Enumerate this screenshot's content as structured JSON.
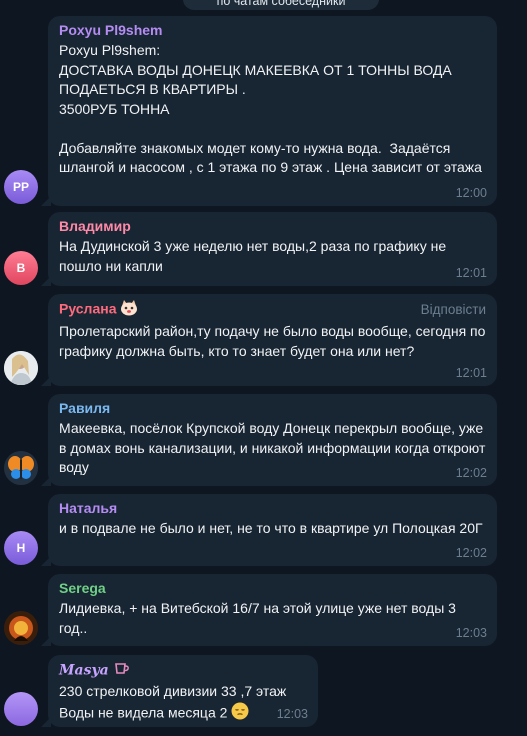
{
  "top_bar": {
    "text": "по чатам собеседники"
  },
  "messages": [
    {
      "sender": "Poxyu Pl9shem",
      "avatar_initials": "PP",
      "text": "Poxyu Pl9shem:\nДОСТАВКА ВОДЫ ДОНЕЦК МАКЕЕВКА ОТ 1 ТОННЫ ВОДА ПОДАЕТЬСЯ В КВАРТИРЫ .\n3500РУБ ТОННА\n\nДобавляйте знакомых модет кому-то нужна вода.  Задаётся шлангой и насосом , с 1 этажа по 9 этаж . Цена зависит от этажа",
      "time": "12:00"
    },
    {
      "sender": "Владимир",
      "avatar_initials": "В",
      "text": "На Дудинской 3 уже неделю нет воды,2 раза по графику не пошло ни капли",
      "time": "12:01"
    },
    {
      "sender": "Руслана",
      "reply_label": "Відповісти",
      "text": "Пролетарский район,ту подачу не было воды вообще, сегодня по графику должна быть, кто то знает будет она или нет?",
      "time": "12:01"
    },
    {
      "sender": "Равиля",
      "text": "Макеевка, посёлок Крупской воду Донецк перекрыл вообще, уже в домах вонь канализации, и никакой информации когда откроют воду",
      "time": "12:02"
    },
    {
      "sender": "Наталья",
      "avatar_initials": "Н",
      "text": "и в подвале не было и нет, не то что в квартире ул Полоцкая 20Г",
      "time": "12:02"
    },
    {
      "sender": "Serega",
      "text": "Лидиевка, + на Витебской 16/7 на этой улице уже нет воды 3 год..",
      "time": "12:03"
    },
    {
      "sender": "𝑴𝒂𝒔𝒚𝒂",
      "text": "230 стрелковой дивизии 33 ,7 этаж\nВоды не видела месяца 2",
      "time": "12:03"
    }
  ],
  "colors": {
    "background": "#0e1621",
    "bubble": "#182533",
    "name_poxyu": "#b48cf2",
    "name_vladimir": "#ff8aa8",
    "name_ruslana": "#ff6b7d",
    "name_ravilya": "#7ab8f0",
    "name_natalya": "#b48cf2",
    "name_serega": "#6fd086",
    "name_masya": "#c7a4ff"
  }
}
